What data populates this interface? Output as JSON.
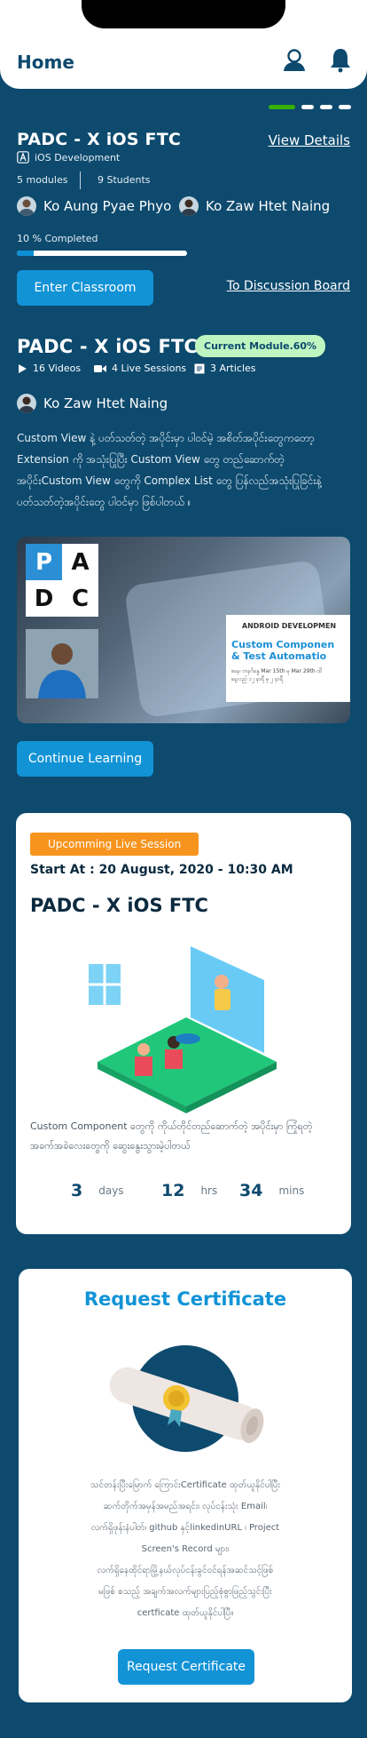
{
  "header": {
    "title": "Home",
    "profile_icon": "user-icon",
    "bell_icon": "bell-icon"
  },
  "carousel": {
    "count": 4,
    "active_index": 0
  },
  "course": {
    "title": "PADC - X iOS FTC",
    "view_details": "View Details",
    "category": "iOS Development",
    "modules": "5 modules",
    "students": "9 Students",
    "teachers": [
      "Ko Aung Pyae Phyo",
      "Ko Zaw Htet Naing"
    ],
    "progress_label": "10 % Completed",
    "progress_value": 0.1,
    "enter_button": "Enter Classroom",
    "discussion_link": "To Discussion Board"
  },
  "module": {
    "title": "PADC - X iOS FTC",
    "chip": "Current Module.60%",
    "videos": "16 Videos",
    "live": "4 Live Sessions",
    "articles": "3 Articles",
    "teacher": "Ko Zaw Htet Naing",
    "description": "Custom View နဲ့ ပတ်သတ်တဲ့ အပိုင်းမှာ ပါဝင်မဲ့ အစိတ်အပိုင်းတွေကတော့ Extension ကို အသုံးပြုပြီး Custom View တွေ တည်ဆောက်တဲ့ အပိုင်းCustom View တွေကို Complex List တွေ ပြန်လည်အသုံးပြုခြင်းနဲ့ ပတ်သတ်တဲ့အပိုင်းတွေ ပါဝင်မှာ ဖြစ်ပါတယ် ။",
    "banner_logo": [
      "P",
      "A",
      "D",
      "C"
    ],
    "banner_heading": "ANDROID DEVELOPMEN",
    "banner_line1": "Custom Componen",
    "banner_line2": "& Test Automatio",
    "banner_small1": "စနေ၊ တနင်္ဂနွေ Mar 15th မှ Mar 29th ထိ",
    "banner_small2": "နေ့လည် ၁၂ နာရီ မှ ၂ နာရီ",
    "continue_button": "Continue Learning"
  },
  "live": {
    "tag": "Upcomming Live Session",
    "start": "Start At : 20 August, 2020 - 10:30 AM",
    "title": "PADC - X iOS FTC",
    "description": "Custom Component တွေကို ကိုယ်တိုင်တည်ဆောက်တဲ့ အပိုင်းမှာ ကြုံရတဲ့ အခက်အခဲလေးတွေကို ဆွေးနွေးသွားမဲ့ပါတယ်",
    "days": "3",
    "days_label": "days",
    "hrs": "12",
    "hrs_label": "hrs",
    "mins": "34",
    "mins_label": "mins"
  },
  "certificate": {
    "title": "Request Certificate",
    "description_lines": [
      "သင်တန်းပြီးမြောက် ကြောင်းCertificate ထုတ်ယူနိုင်ပါပြီး",
      "ဆက်တိုက်အမှန်အမည်အရင်း၊ လုပ်ငန်းသုံး Email၊",
      "လက်ရှိဖုန်းနံပါတ်၊ github နှင့်linkedinURL ၊ Project",
      "Screen's Record များ၊",
      "လက်ရှိနေထိုင်ရာမြို့နယ်လုပ်ငန်းခွင်ဝင်ရန်အဆင်သင့်ဖြစ်",
      "မဖြစ် စသည့် အချက်အလက်များပြည့်စုံစွာဖြည့်သွင်းပြီး",
      "certficate ထုတ်ယူနိုင်ပါပြီ။"
    ],
    "button": "Request Certificate"
  },
  "colors": {
    "primary": "#0d4a6e",
    "accent": "#1293d6",
    "green": "#38b000",
    "orange": "#f7941d"
  }
}
